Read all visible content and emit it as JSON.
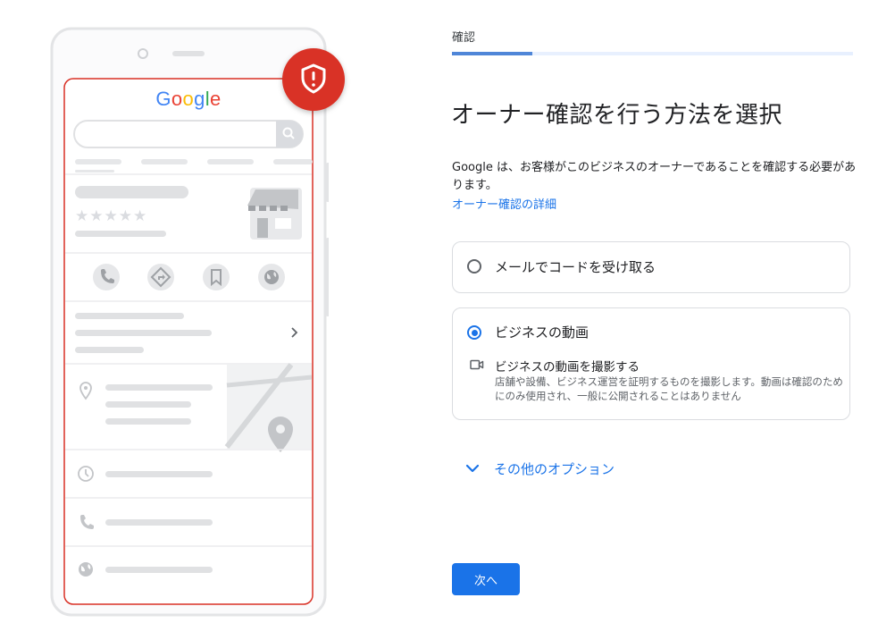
{
  "illustration": {
    "search_logo": "Google",
    "logo_colors": [
      "#4285f4",
      "#ea4335",
      "#fbbc05",
      "#4285f4",
      "#34a853",
      "#ea4335"
    ],
    "rating_stars": "★★★★★",
    "badge_icon": "shield-alert-icon",
    "accent_color": "#d93025"
  },
  "step": {
    "label": "確認",
    "progress": 0.2
  },
  "page_title": "オーナー確認を行う方法を選択",
  "description": "Google は、お客様がこのビジネスのオーナーであることを確認する必要があります。",
  "learn_more_link": "オーナー確認の詳細",
  "options": [
    {
      "label": "メールでコードを受け取る",
      "selected": false
    },
    {
      "label": "ビジネスの動画",
      "selected": true,
      "sub_icon": "videocam-icon",
      "sub_title": "ビジネスの動画を撮影する",
      "sub_description": "店舗や設備、ビジネス運営を証明するものを撮影します。動画は確認のためにのみ使用され、一般に公開されることはありません"
    }
  ],
  "more_options": {
    "label": "その他のオプション",
    "icon": "chevron-down-icon"
  },
  "next_button": "次へ",
  "colors": {
    "primary": "#1a73e8",
    "border": "#dadce0",
    "progress_track": "#e8f0fe"
  }
}
